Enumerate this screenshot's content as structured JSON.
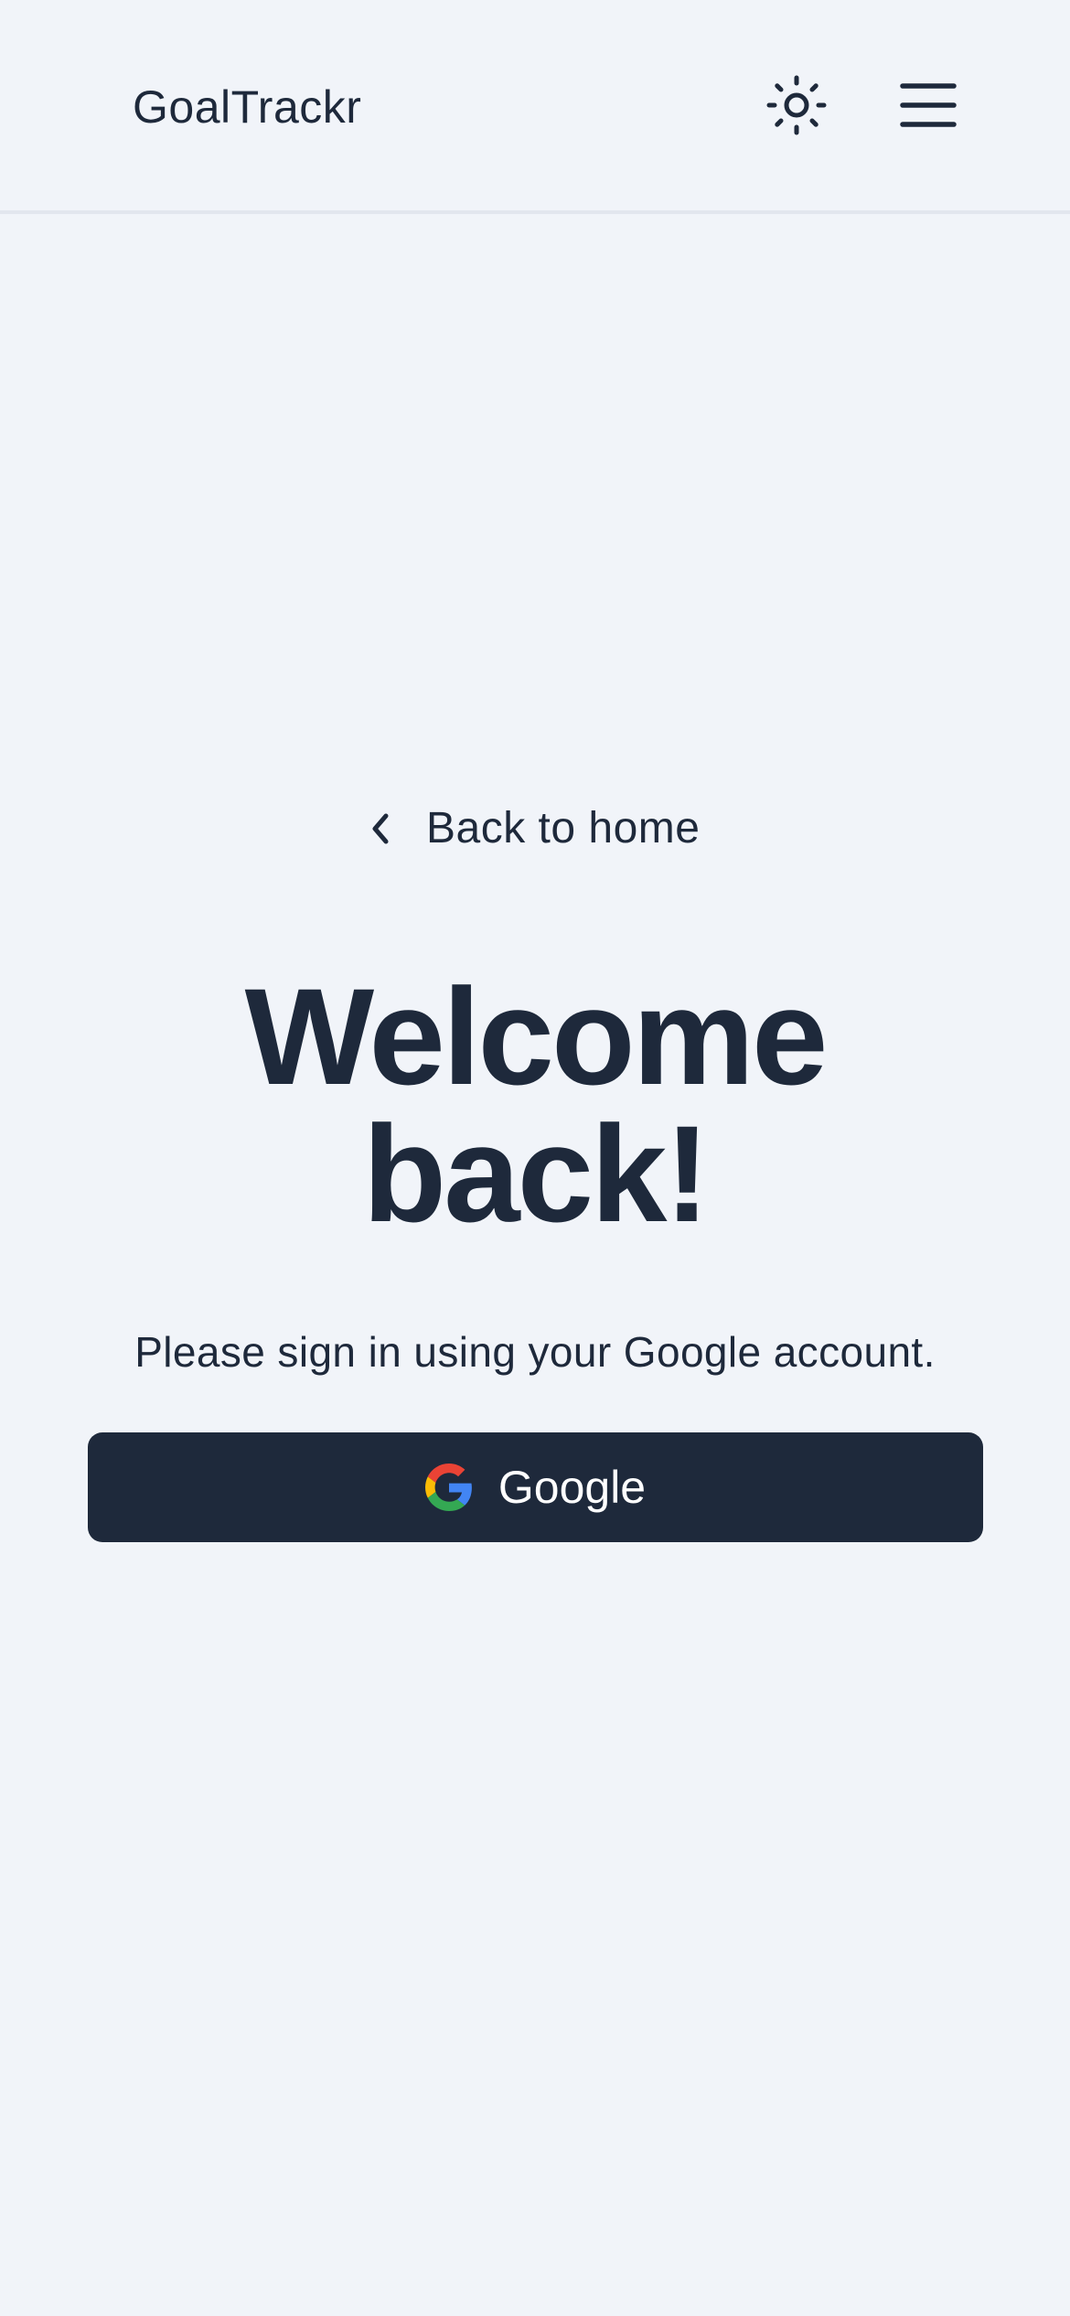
{
  "header": {
    "brand": "GoalTrackr",
    "theme_toggle_icon": "sun-icon",
    "menu_icon": "hamburger-menu-icon"
  },
  "main": {
    "back_link": {
      "icon": "chevron-left-icon",
      "label": "Back to home"
    },
    "title_line1": "Welcome",
    "title_line2": "back!",
    "subtitle": "Please sign in using your Google account.",
    "google_button": {
      "icon": "google-icon",
      "label": "Google"
    }
  },
  "colors": {
    "background": "#f1f4f9",
    "text": "#1e293b",
    "button_bg": "#1e293b",
    "button_text": "#ffffff",
    "divider": "#e2e6ee"
  }
}
